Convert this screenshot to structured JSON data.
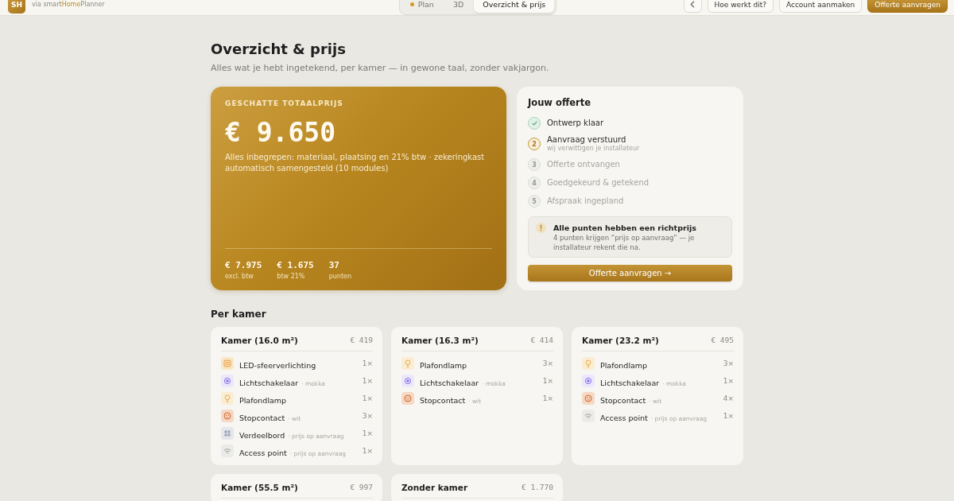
{
  "header": {
    "logo_text": "SH",
    "brand": "via smart**Home**Planner",
    "tabs": [
      {
        "label": "Plan",
        "dot": true,
        "selected": false
      },
      {
        "label": "3D",
        "dot": false,
        "selected": false
      },
      {
        "label": "Overzicht & prijs",
        "dot": false,
        "selected": true
      }
    ],
    "actions": [
      {
        "kind": "icon"
      },
      {
        "kind": "outline",
        "label": "Hoe werkt dit?"
      },
      {
        "kind": "outline",
        "label": "Account aanmaken"
      },
      {
        "kind": "primary",
        "label": "Offerte aanvragen"
      }
    ]
  },
  "page": {
    "title": "Overzicht & prijs",
    "subtitle": "Alles wat je hebt ingetekend, per kamer — in gewone taal, zonder vakjargon."
  },
  "total": {
    "label": "GESCHATTE TOTAALPRIJS",
    "amount": "€ 9.650",
    "description": "Alles inbegrepen: materiaal, plaatsing en 21% btw · zekeringkast automatisch samengesteld (10 modules)",
    "stats": [
      {
        "value": "€ 7.975",
        "label": "excl. btw"
      },
      {
        "value": "€ 1.675",
        "label": "btw 21%"
      },
      {
        "value": "37",
        "label": "punten"
      }
    ]
  },
  "offer": {
    "title": "Jouw offerte",
    "steps": [
      {
        "label": "Ontwerp klaar",
        "done": true,
        "active": false
      },
      {
        "number": "2",
        "label": "Aanvraag verstuurd",
        "sub": "wij verwittigen je installateur",
        "done": false,
        "active": true
      },
      {
        "number": "3",
        "label": "Offerte ontvangen",
        "done": false,
        "active": false
      },
      {
        "number": "4",
        "label": "Goedgekeurd & getekend",
        "done": false,
        "active": false
      },
      {
        "number": "5",
        "label": "Afspraak ingepland",
        "done": false,
        "active": false
      }
    ],
    "notice": {
      "title": "Alle punten hebben een richtprijs",
      "text": "4 punten krijgen “prijs op aanvraag” — je installateur rekent die na."
    },
    "button": "Offerte aanvragen →"
  },
  "rooms_heading": "Per kamer",
  "rooms": [
    {
      "title": "Kamer (16.0 m²)",
      "price": "€ 419",
      "items": [
        {
          "kind": "led",
          "name": "LED-sfeerverlichting",
          "quantity": "1×"
        },
        {
          "kind": "switch",
          "name": "Lichtschakelaar",
          "note": "· mokka",
          "quantity": "1×"
        },
        {
          "kind": "lamp",
          "name": "Plafondlamp",
          "quantity": "1×"
        },
        {
          "kind": "socket",
          "name": "Stopcontact",
          "note": "· wit",
          "quantity": "3×"
        },
        {
          "kind": "panel",
          "name": "Verdeelbord",
          "note": "· prijs op aanvraag",
          "quantity": "1×"
        },
        {
          "kind": "wifi",
          "name": "Access point",
          "note": "· prijs op aanvraag",
          "quantity": "1×"
        }
      ]
    },
    {
      "title": "Kamer (16.3 m²)",
      "price": "€ 414",
      "items": [
        {
          "kind": "lamp",
          "name": "Plafondlamp",
          "quantity": "3×"
        },
        {
          "kind": "switch",
          "name": "Lichtschakelaar",
          "note": "· mokka",
          "quantity": "1×"
        },
        {
          "kind": "socket",
          "name": "Stopcontact",
          "note": "· wit",
          "quantity": "1×"
        }
      ]
    },
    {
      "title": "Kamer (23.2 m²)",
      "price": "€ 495",
      "items": [
        {
          "kind": "lamp",
          "name": "Plafondlamp",
          "quantity": "3×"
        },
        {
          "kind": "switch",
          "name": "Lichtschakelaar",
          "note": "· mokka",
          "quantity": "1×"
        },
        {
          "kind": "socket",
          "name": "Stopcontact",
          "note": "· wit",
          "quantity": "4×"
        },
        {
          "kind": "wifi",
          "name": "Access point",
          "note": "· prijs op aanvraag",
          "quantity": "1×"
        }
      ]
    },
    {
      "title": "Kamer (55.5 m²)",
      "price": "€ 997"
    },
    {
      "title": "Zonder kamer",
      "price": "€ 1.770"
    }
  ]
}
